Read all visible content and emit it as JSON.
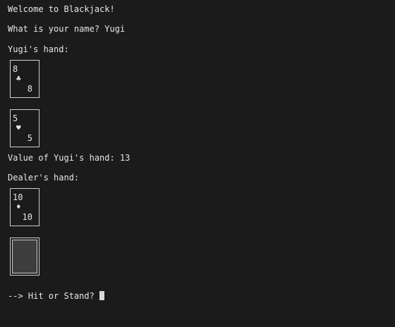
{
  "terminal": {
    "welcome": "Welcome to Blackjack!",
    "name_prompt": "What is your name? Yugi",
    "player_hand_label": "Yugi's hand:",
    "player_value": "Value of Yugi's hand: 13",
    "dealer_hand_label": "Dealer's hand:",
    "action_prompt": "--> Hit or Stand?"
  },
  "player_cards": [
    {
      "rank": "8",
      "suit": "♣"
    },
    {
      "rank": "5",
      "suit": "♥"
    }
  ],
  "dealer_cards": [
    {
      "rank": "10",
      "suit": "♦"
    }
  ],
  "dealer_hidden_card": "face-down"
}
